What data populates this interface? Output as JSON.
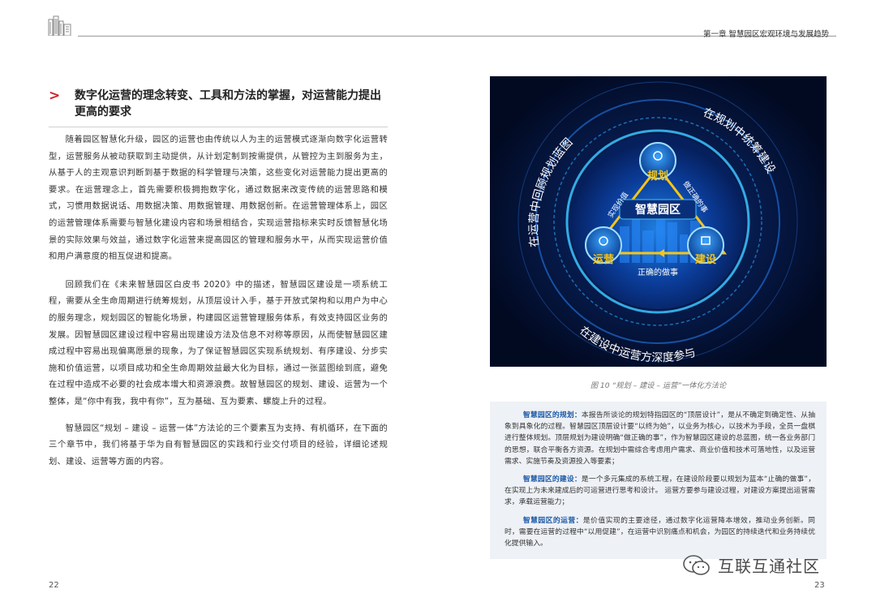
{
  "header": {
    "chapter_title": "第一章 智慧园区宏观环境与发展趋势"
  },
  "section": {
    "marker": ">",
    "heading": "数字化运营的理念转变、工具和方法的掌握，对运营能力提出更高的要求"
  },
  "paragraphs": [
    "随着园区智慧化升级，园区的运营也由传统以人为主的运营模式逐渐向数字化运营转型，运营服务从被动获取到主动提供，从计划定制到按需提供，从管控为主到服务为主，从基于人的主观意识判断到基于数据的科学管理与决策，这些变化对运营能力提出更高的要求。在运营理念上，首先需要积极拥抱数字化，通过数据来改变传统的运营思路和模式，习惯用数据说话、用数据决策、用数据管理、用数据创新。在运营管理体系上，园区的运营管理体系需要与智慧化建设内容和场景相结合，实现运营指标来实时反馈智慧化场景的实际效果与效益，通过数字化运营来提高园区的管理和服务水平，从而实现运营价值和用户满意度的相互促进和提高。",
    "回顾我们在《未来智慧园区白皮书 2020》中的描述，智慧园区建设是一项系统工程，需要从全生命周期进行统筹规划，从顶层设计入手，基于开放式架构和以用户为中心的服务理念，规划园区的智能化场景，构建园区运营管理服务体系，有效支持园区业务的发展。因智慧园区建设过程中容易出现建设方法及信息不对称等原因，从而使智慧园区建成过程中容易出现偏离愿景的现象，为了保证智慧园区实现系统规划、有序建设、分步实施和价值运营，以项目成功和全生命周期效益最大化为目标，通过一张蓝图绘到底，避免在过程中造成不必要的社会成本增大和资源浪费。故智慧园区的规划、建设、运营为一个整体，是“你中有我，我中有你”，互为基础、互为要素、螺旋上升的过程。",
    "智慧园区“规划 – 建设 – 运营一体”方法论的三个要素互为支持、有机循环，在下面的三个章节中，我们将基于华为自有智慧园区的实践和行业交付项目的经验，详细论述规划、建设、运营等方面的内容。"
  ],
  "figure": {
    "center_label": "智慧园区",
    "node_plan": "规划",
    "node_build": "建设",
    "node_operate": "运营",
    "edge_left": "实现价值",
    "edge_right": "做正确的事",
    "edge_bottom": "正确的做事",
    "ring_left": "在运营中回顾规划蓝图",
    "ring_right": "在规划中统筹建设",
    "ring_bottom": "在建设中运营方深度参与",
    "caption": "图 10 “规划 – 建设 – 运营”一体化方法论",
    "colors": {
      "background": "#04102e",
      "glow": "#1ea0ff",
      "triangle": "#f5c518"
    }
  },
  "definitions": [
    {
      "term": "智慧园区的规划：",
      "text": "本报告所谈论的规划特指园区的“顶层设计”，是从不确定到确定性、从抽象到具象化的过程。智慧园区顶层设计要“以终为始”，以业务为核心，以技术为手段，全员一盘棋进行整体规划。顶层规划为建设明确“做正确的事”，作为智慧园区建设的总蓝图，统一各业务部门的思想，联合平衡各方资源。在规划中需综合考虑用户需求、商业价值和技术可落地性，以及运营需求、实施节奏及资源投入等要素；"
    },
    {
      "term": "智慧园区的建设：",
      "text": "是一个多元集成的系统工程，在建设阶段要以规划为蓝本“止确的做事”，在实现上为未来建成后的可运营进行思考和设计。 运营方要参与建设过程，对建设方案提出运营需求，承载运营能力；"
    },
    {
      "term": "智慧园区的运营：",
      "text": "是价值实现的主要途径，通过数字化运营降本增效，推动业务创新。同时，需要在运营的过程中“以用促建”，在运营中识别痛点和机会，为园区的持续迭代和业务持续优化提供输入。"
    }
  ],
  "pages": {
    "left": "22",
    "right": "23"
  },
  "watermark": {
    "text": "互联互通社区",
    "icon": "wechat-icon"
  }
}
